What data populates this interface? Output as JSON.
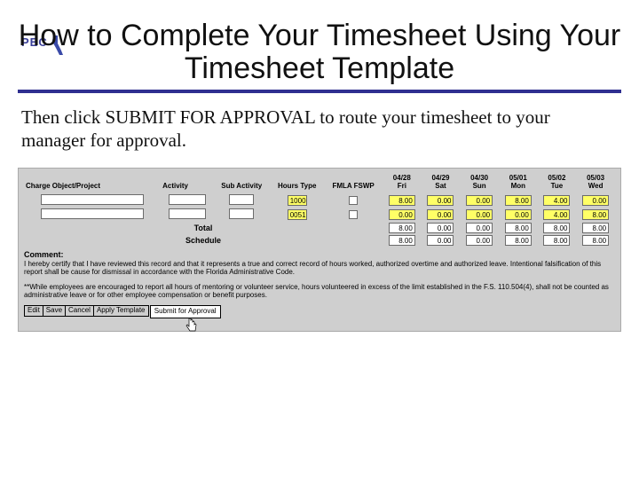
{
  "logoText": "PEC",
  "title": "How to Complete Your Timesheet Using Your Timesheet Template",
  "instruction": "Then click SUBMIT FOR APPROVAL to route your timesheet to your manager for approval.",
  "headers": {
    "chargeObject": "Charge Object/Project",
    "activity": "Activity",
    "subActivity": "Sub Activity",
    "hoursType": "Hours Type",
    "fmla": "FMLA FSWP",
    "dates": [
      {
        "md": "04/28",
        "dow": "Fri"
      },
      {
        "md": "04/29",
        "dow": "Sat"
      },
      {
        "md": "04/30",
        "dow": "Sun"
      },
      {
        "md": "05/01",
        "dow": "Mon"
      },
      {
        "md": "05/02",
        "dow": "Tue"
      },
      {
        "md": "05/03",
        "dow": "Wed"
      }
    ]
  },
  "rows": [
    {
      "hoursType": "1000",
      "values": [
        "8.00",
        "0.00",
        "0.00",
        "8.00",
        "4.00",
        "0.00"
      ]
    },
    {
      "hoursType": "0051",
      "values": [
        "0.00",
        "0.00",
        "0.00",
        "0.00",
        "4.00",
        "8.00"
      ]
    }
  ],
  "totalsLabel": "Total",
  "totals": [
    "8.00",
    "0.00",
    "0.00",
    "8.00",
    "8.00",
    "8.00"
  ],
  "scheduleLabel": "Schedule",
  "schedule": [
    "8.00",
    "0.00",
    "0.00",
    "8.00",
    "8.00",
    "8.00"
  ],
  "commentLabel": "Comment:",
  "certLine1": "I hereby certify that I have reviewed this record and that it represents a true and correct record of hours worked, authorized overtime and authorized leave. Intentional falsification of this report shall be cause for dismissal in accordance with the Florida Administrative Code.",
  "certLine2": "**While employees are encouraged to report all hours of mentoring or volunteer service, hours volunteered in excess of the limit established in the F.S. 110.504(4), shall not be counted as administrative leave or for other employee compensation or benefit purposes.",
  "buttons": {
    "edit": "Edit",
    "save": "Save",
    "cancel": "Cancel",
    "applyTemplate": "Apply Template",
    "submit": "Submit for Approval"
  }
}
